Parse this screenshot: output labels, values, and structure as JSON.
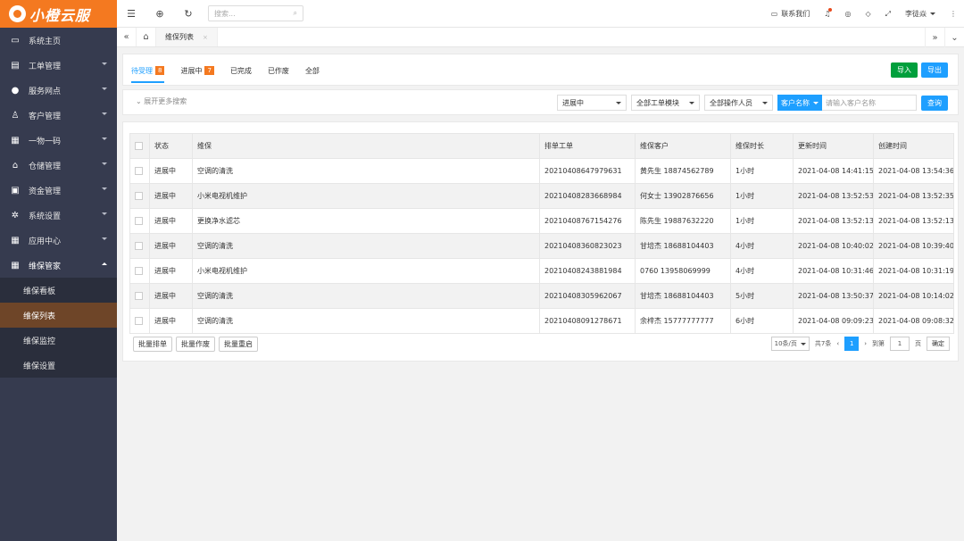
{
  "brand": {
    "name": "小橙云服",
    "color": "#f47920"
  },
  "sidebar": {
    "items": [
      {
        "label": "系统主页",
        "icon": "monitor-icon",
        "glyph": "▭"
      },
      {
        "label": "工单管理",
        "icon": "document-icon",
        "glyph": "▤"
      },
      {
        "label": "服务网点",
        "icon": "location-icon",
        "glyph": "●"
      },
      {
        "label": "客户管理",
        "icon": "user-icon",
        "glyph": "♙"
      },
      {
        "label": "一物一码",
        "icon": "grid-icon",
        "glyph": "▦"
      },
      {
        "label": "仓储管理",
        "icon": "warehouse-icon",
        "glyph": "⌂"
      },
      {
        "label": "资金管理",
        "icon": "money-icon",
        "glyph": "▣"
      },
      {
        "label": "系统设置",
        "icon": "gear-icon",
        "glyph": "✲"
      },
      {
        "label": "应用中心",
        "icon": "apps-icon",
        "glyph": "▦"
      }
    ],
    "open_group": {
      "label": "维保管家",
      "icon": "grid-icon",
      "glyph": "▦",
      "children": [
        "维保看板",
        "维保列表",
        "维保监控",
        "维保设置"
      ]
    }
  },
  "topbar": {
    "search_placeholder": "搜索...",
    "contact_label": "联系我们",
    "user_name": "李徒焱"
  },
  "tabs": {
    "current": "维保列表",
    "close_glyph": "×"
  },
  "status_tabs": [
    {
      "label": "待受理",
      "badge": "8"
    },
    {
      "label": "进展中",
      "badge": "7"
    },
    {
      "label": "已完成",
      "badge": ""
    },
    {
      "label": "已作废",
      "badge": ""
    },
    {
      "label": "全部",
      "badge": ""
    }
  ],
  "actions": {
    "import": "导入",
    "export": "导出"
  },
  "filters": {
    "expand_label": "展开更多搜索",
    "status": "进展中",
    "module": "全部工单模块",
    "operator": "全部操作人员",
    "field": "客户名称",
    "input_placeholder": "请输入客户名称",
    "query": "查询"
  },
  "table": {
    "columns": [
      "状态",
      "维保",
      "排单工单",
      "维保客户",
      "维保时长",
      "更新时间",
      "创建时间"
    ],
    "rows": [
      [
        "进展中",
        "空调的清洗",
        "20210408647979631",
        "黄先生 18874562789",
        "1小时",
        "2021-04-08 14:41:15",
        "2021-04-08 13:54:36"
      ],
      [
        "进展中",
        "小米电视机维护",
        "20210408283668984",
        "何女士 13902876656",
        "1小时",
        "2021-04-08 13:52:53",
        "2021-04-08 13:52:35"
      ],
      [
        "进展中",
        "更换净水滤芯",
        "20210408767154276",
        "陈先生 19887632220",
        "1小时",
        "2021-04-08 13:52:13",
        "2021-04-08 13:52:13"
      ],
      [
        "进展中",
        "空调的清洗",
        "20210408360823023",
        "甘培杰 18688104403",
        "4小时",
        "2021-04-08 10:40:02",
        "2021-04-08 10:39:40"
      ],
      [
        "进展中",
        "小米电视机维护",
        "20210408243881984",
        "0760 13958069999",
        "4小时",
        "2021-04-08 10:31:46",
        "2021-04-08 10:31:19"
      ],
      [
        "进展中",
        "空调的清洗",
        "20210408305962067",
        "甘培杰 18688104403",
        "5小时",
        "2021-04-08 13:50:37",
        "2021-04-08 10:14:02"
      ],
      [
        "进展中",
        "空调的清洗",
        "20210408091278671",
        "余梓杰 15777777777",
        "6小时",
        "2021-04-08 09:09:23",
        "2021-04-08 09:08:32"
      ]
    ]
  },
  "batch": {
    "dispatch": "批量排单",
    "void": "批量作废",
    "restart": "批量重启"
  },
  "pager": {
    "page_size": "10条/页",
    "total": "共7条",
    "current_page": "1",
    "goto_label": "到第",
    "goto_value": "1",
    "page_unit": "页",
    "confirm": "确定"
  }
}
